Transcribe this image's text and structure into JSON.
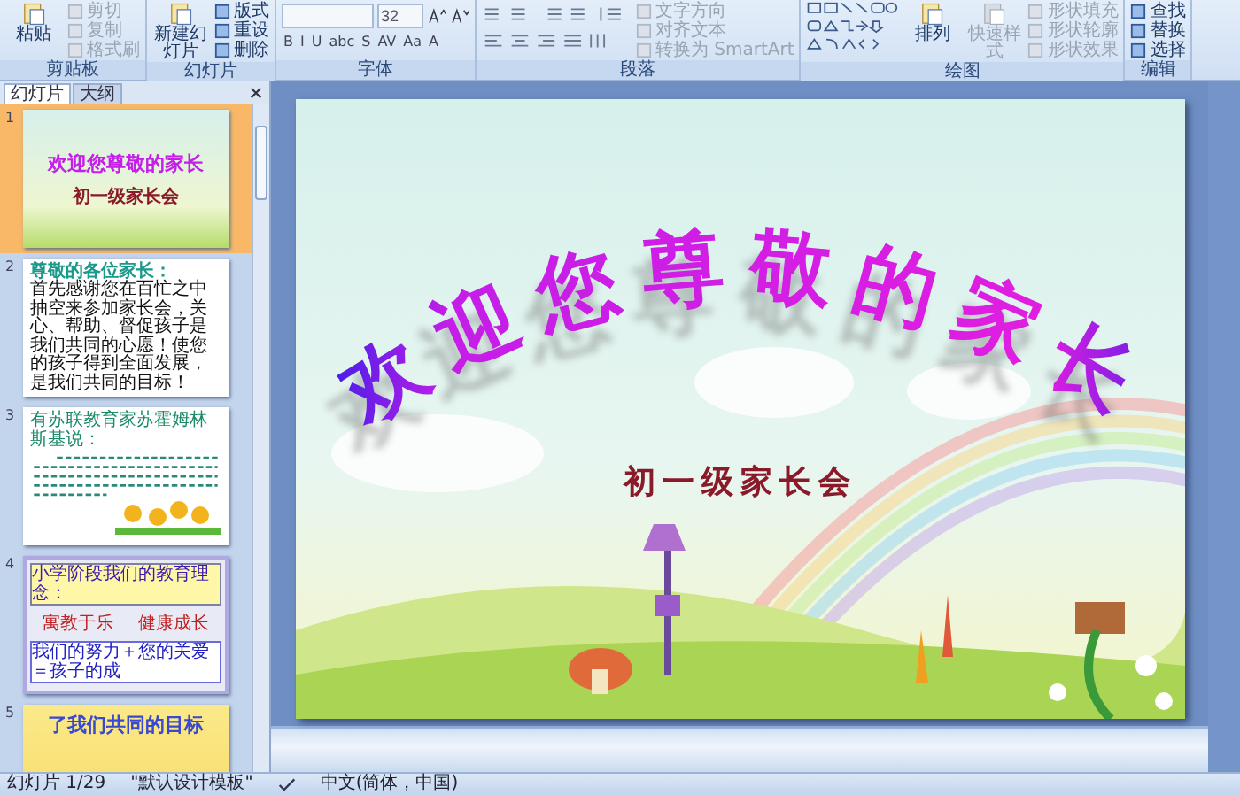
{
  "ribbon": {
    "groups": [
      {
        "name": "剪贴板",
        "kind": "buttons",
        "large": [
          {
            "label": "粘贴",
            "disabled": false
          }
        ],
        "small": [
          {
            "label": "剪切",
            "disabled": true
          },
          {
            "label": "复制",
            "disabled": true
          },
          {
            "label": "格式刷",
            "disabled": true
          }
        ]
      },
      {
        "name": "幻灯片",
        "kind": "buttons",
        "large": [
          {
            "label": "新建幻灯片",
            "disabled": false
          }
        ],
        "small": [
          {
            "label": "版式",
            "disabled": false
          },
          {
            "label": "重设",
            "disabled": false
          },
          {
            "label": "删除",
            "disabled": false
          }
        ]
      },
      {
        "name": "字体",
        "kind": "font",
        "font_size": "32",
        "format_buttons": [
          "B",
          "I",
          "U",
          "abc",
          "S",
          "AV",
          "Aa",
          "A"
        ]
      },
      {
        "name": "段落",
        "kind": "paragraph",
        "small": [
          {
            "label": "文字方向",
            "disabled": true
          },
          {
            "label": "对齐文本",
            "disabled": true
          },
          {
            "label": "转换为 SmartArt",
            "disabled": true
          }
        ]
      },
      {
        "name": "绘图",
        "kind": "drawing",
        "large": [
          {
            "label": "排列",
            "disabled": false
          },
          {
            "label": "快速样式",
            "disabled": true
          }
        ],
        "small": [
          {
            "label": "形状填充",
            "disabled": true
          },
          {
            "label": "形状轮廓",
            "disabled": true
          },
          {
            "label": "形状效果",
            "disabled": true
          }
        ]
      },
      {
        "name": "编辑",
        "kind": "buttons",
        "small": [
          {
            "label": "查找",
            "disabled": false
          },
          {
            "label": "替换",
            "disabled": false
          },
          {
            "label": "选择",
            "disabled": false
          }
        ]
      }
    ]
  },
  "panel": {
    "tabs": [
      {
        "label": "幻灯片",
        "selected": true
      },
      {
        "label": "大纲",
        "selected": false
      }
    ],
    "slides": [
      {
        "number": "1",
        "kind": "title",
        "selected": true,
        "title": "欢迎您尊敬的家长",
        "subtitle": "初一级家长会"
      },
      {
        "number": "2",
        "kind": "letter",
        "selected": false,
        "heading": "尊敬的各位家长：",
        "body": "首先感谢您在百忙之中抽空来参加家长会，关心、帮助、督促孩子是我们共同的心愿！使您的孩子得到全面发展，是我们共同的目标！"
      },
      {
        "number": "3",
        "kind": "quote",
        "selected": false,
        "heading": "有苏联教育家苏霍姆林斯基说："
      },
      {
        "number": "4",
        "kind": "motto",
        "selected": false,
        "heading": "小学阶段我们的教育理念：",
        "items": [
          "寓教于乐",
          "健康成长"
        ],
        "banner": "我们的努力＋您的关爱＝孩子的成"
      },
      {
        "number": "5",
        "kind": "banner",
        "selected": false,
        "title": "了我们共同的目标"
      }
    ]
  },
  "slide": {
    "title": "欢迎您尊敬的家长",
    "subtitle": "初一级家长会"
  },
  "status_bar": {
    "slide_counter": "幻灯片 1/29",
    "theme": "\"默认设计模板\"",
    "language": "中文(简体，中国)"
  }
}
